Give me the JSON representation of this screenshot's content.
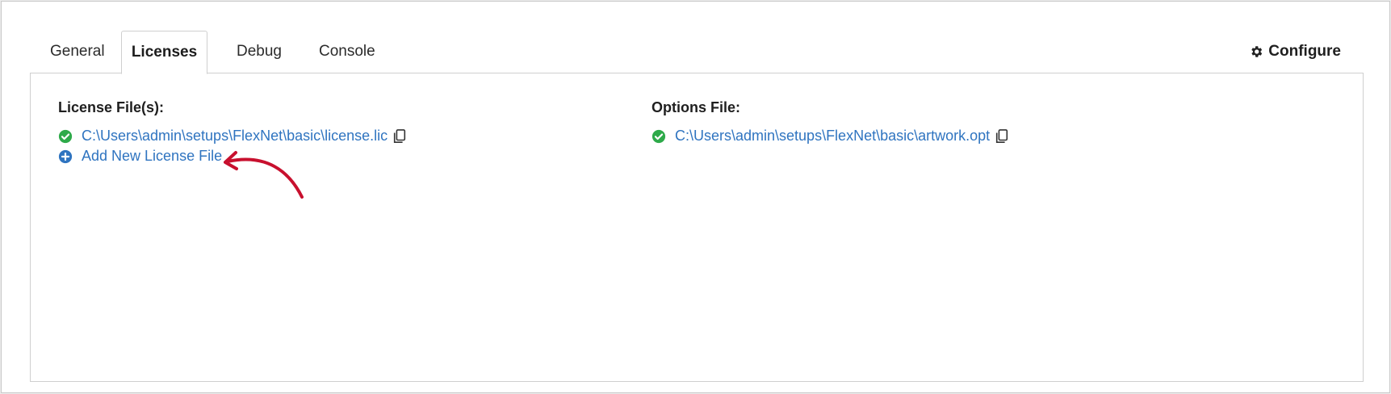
{
  "tabs": [
    {
      "label": "General"
    },
    {
      "label": "Licenses",
      "active": true
    },
    {
      "label": "Debug"
    },
    {
      "label": "Console"
    }
  ],
  "configure": {
    "label": "Configure",
    "icon": "gear-icon"
  },
  "license_section": {
    "title": "License File(s):",
    "files": [
      {
        "path": "C:\\Users\\admin\\setups\\FlexNet\\basic\\license.lic",
        "status": "ok"
      }
    ],
    "add_label": "Add New License File"
  },
  "options_section": {
    "title": "Options File:",
    "files": [
      {
        "path": "C:\\Users\\admin\\setups\\FlexNet\\basic\\artwork.opt",
        "status": "ok"
      }
    ]
  },
  "colors": {
    "link": "#2f74c0",
    "success": "#2eaa4a",
    "add": "#2f74c0",
    "annotation": "#c8102e"
  }
}
